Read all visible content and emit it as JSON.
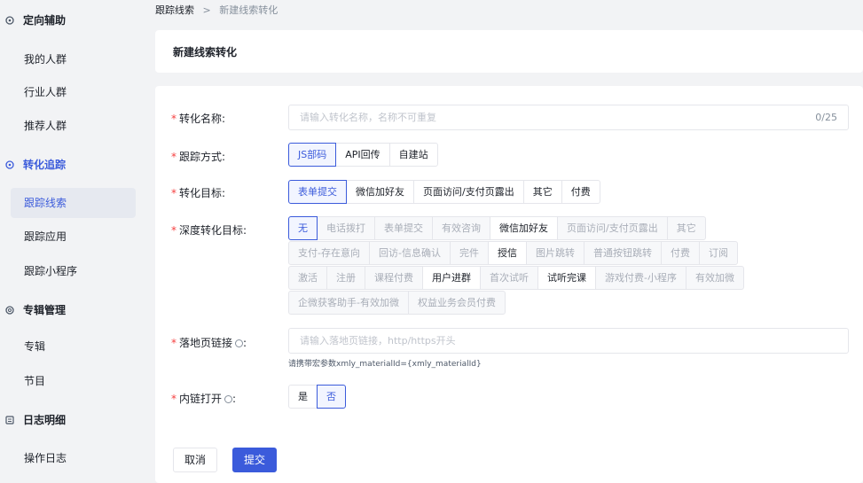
{
  "sidebar": {
    "sec1": "定向辅助",
    "sec1_items": [
      "我的人群",
      "行业人群",
      "推荐人群"
    ],
    "sec2": "转化追踪",
    "sec2_items": [
      "跟踪线索",
      "跟踪应用",
      "跟踪小程序"
    ],
    "sec3": "专辑管理",
    "sec3_items": [
      "专辑",
      "节目"
    ],
    "sec4": "日志明细",
    "sec4_items": [
      "操作日志"
    ]
  },
  "breadcrumb": {
    "parent": "跟踪线索",
    "sep": ">",
    "current": "新建线索转化"
  },
  "page_title": "新建线索转化",
  "form": {
    "name_label": "转化名称:",
    "name_placeholder": "请输入转化名称，名称不可重复",
    "name_count": "0/25",
    "track_label": "跟踪方式:",
    "track_opts": [
      "JS部码",
      "API回传",
      "自建站"
    ],
    "goal_label": "转化目标:",
    "goal_opts": [
      "表单提交",
      "微信加好友",
      "页面访问/支付页露出",
      "其它",
      "付费"
    ],
    "deep_label": "深度转化目标:",
    "deep_row1": [
      "无",
      "电话拨打",
      "表单提交",
      "有效咨询",
      "微信加好友",
      "页面访问/支付页露出",
      "其它"
    ],
    "deep_row2": [
      "支付-存在意向",
      "回访-信息确认",
      "完件",
      "授信",
      "图片跳转",
      "普通按钮跳转",
      "付费",
      "订阅"
    ],
    "deep_row3": [
      "激活",
      "注册",
      "课程付费",
      "用户进群",
      "首次试听",
      "试听完课",
      "游戏付费-小程序",
      "有效加微"
    ],
    "deep_row4": [
      "企微获客助手-有效加微",
      "权益业务会员付费"
    ],
    "landing_label": "落地页链接",
    "landing_placeholder": "请输入落地页链接，http/https开头",
    "landing_hint": "请携带宏参数xmly_materialId={xmly_materialId}",
    "inlink_label": "内链打开",
    "inlink_opts": [
      "是",
      "否"
    ],
    "cancel": "取消",
    "submit": "提交"
  },
  "colors": {
    "accent": "#3b5bdb",
    "required": "#f53f3f"
  }
}
